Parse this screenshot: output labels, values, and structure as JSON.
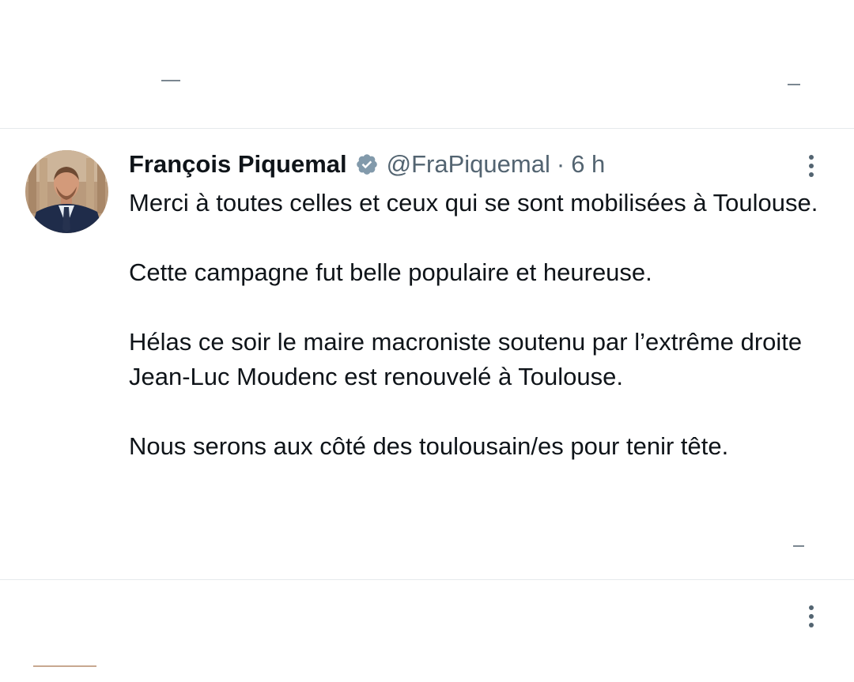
{
  "tweet": {
    "author_name": "François Piquemal",
    "handle": "@FraPiquemal",
    "separator": "·",
    "time": "6 h",
    "paragraphs": [
      {
        "text": "Merci à toutes celles et ceux qui se sont mobilisées à Toulouse."
      },
      {
        "text": "Cette campagne fut belle populaire et heureuse."
      },
      {
        "before": "Hélas ce soir le maire macroniste soutenu par l’",
        "highlight": "extrême droite",
        "after": " Jean-Luc Moudenc est renouvelé à Toulouse."
      },
      {
        "text": "Nous serons aux côté des toulousain/es pour tenir tête."
      }
    ]
  },
  "colors": {
    "text_primary": "#0f1419",
    "text_secondary": "#536471",
    "verified_badge": "#829aab",
    "highlight": "#f8f77a",
    "divider": "#e6e9ec"
  },
  "icons": {
    "verified": "verified-badge-icon",
    "more": "more-options-icon"
  }
}
